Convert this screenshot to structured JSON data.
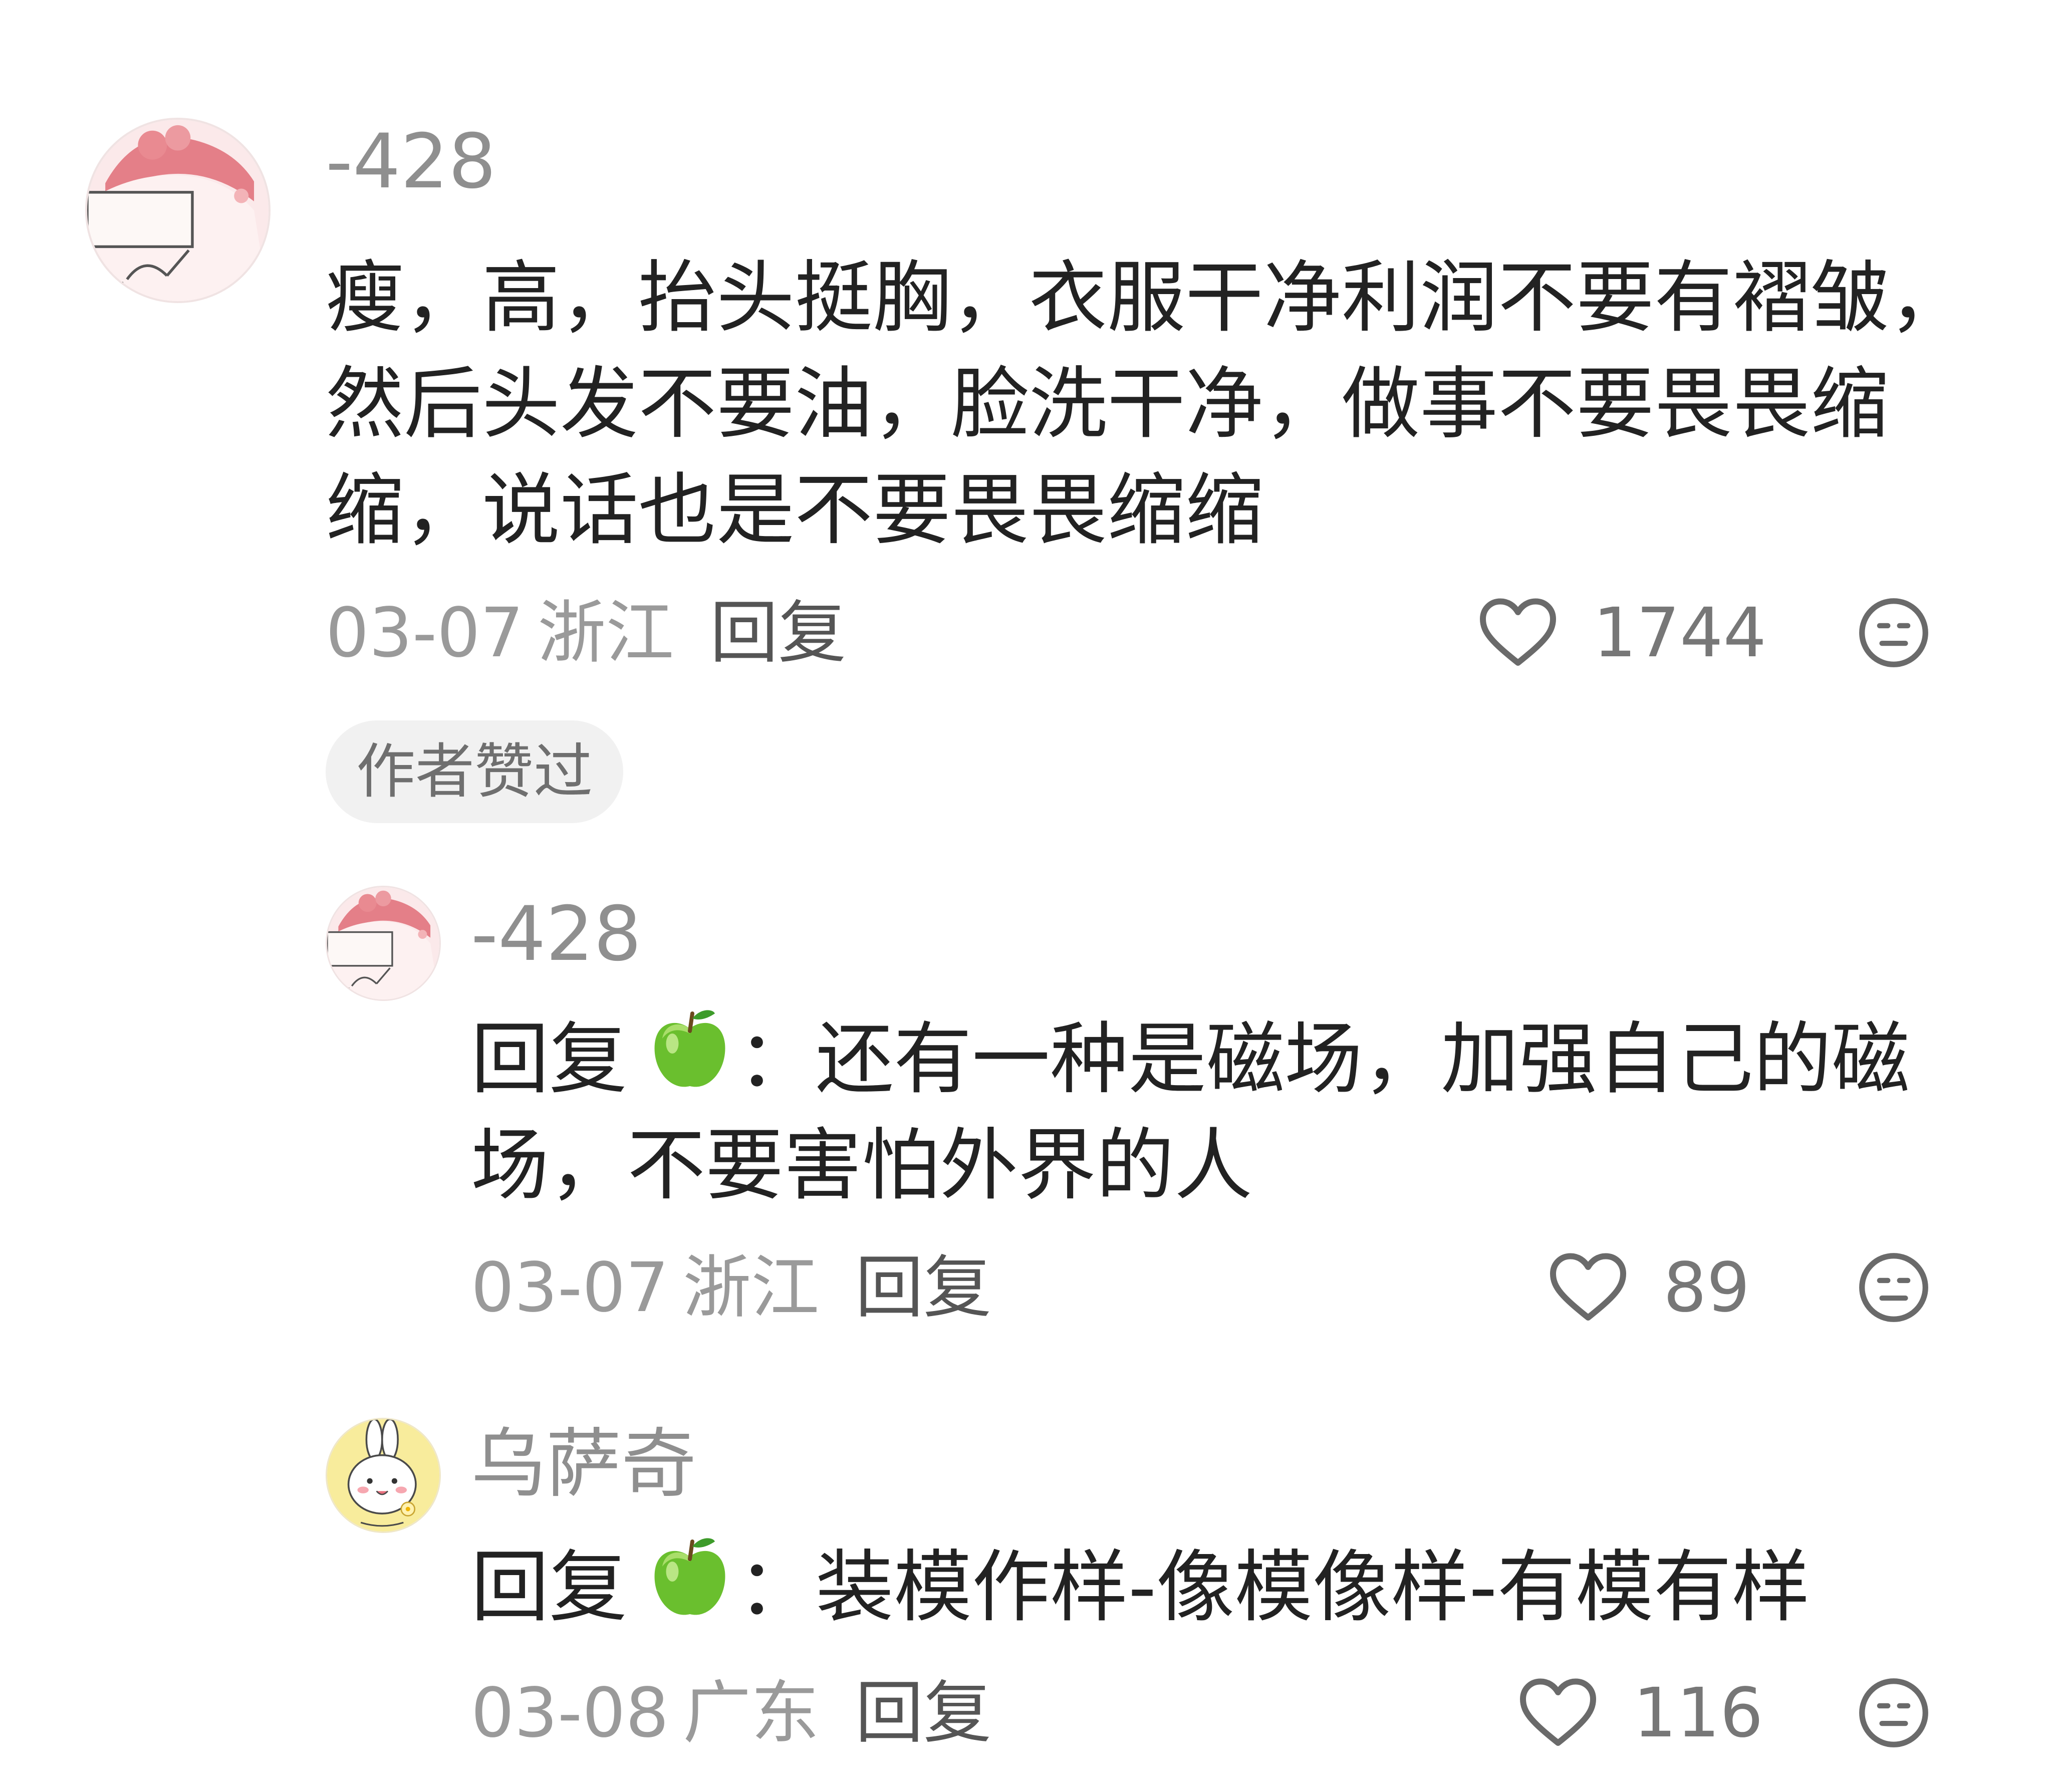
{
  "comments": [
    {
      "username": "-428",
      "text": "瘦，高，抬头挺胸，衣服干净利润不要有褶皱，然后头发不要油，脸洗干净，做事不要畏畏缩缩，说话也是不要畏畏缩缩",
      "date": "03-07",
      "location": "浙江",
      "reply_label": "回复",
      "likes": "1744",
      "badge": "作者赞过",
      "replies": [
        {
          "username": "-428",
          "reply_prefix": "回复",
          "reply_target_icon": "green-apple-icon",
          "separator": "：",
          "text": "还有一种是磁场，加强自己的磁场，不要害怕外界的人",
          "date": "03-07",
          "location": "浙江",
          "reply_label": "回复",
          "likes": "89"
        },
        {
          "username": "乌萨奇",
          "reply_prefix": "回复",
          "reply_target_icon": "green-apple-icon",
          "separator": "：",
          "text": "装模作样-像模像样-有模有样",
          "date": "03-08",
          "location": "广东",
          "reply_label": "回复",
          "likes": "116"
        }
      ]
    }
  ],
  "icons": {
    "like": "heart-outline-icon",
    "dislike": "meh-face-icon"
  },
  "colors": {
    "text": "#222222",
    "username": "#8f8f8f",
    "meta": "#9a9a9a",
    "icon": "#6a6a6a",
    "badge_bg": "#f1f1f1"
  }
}
